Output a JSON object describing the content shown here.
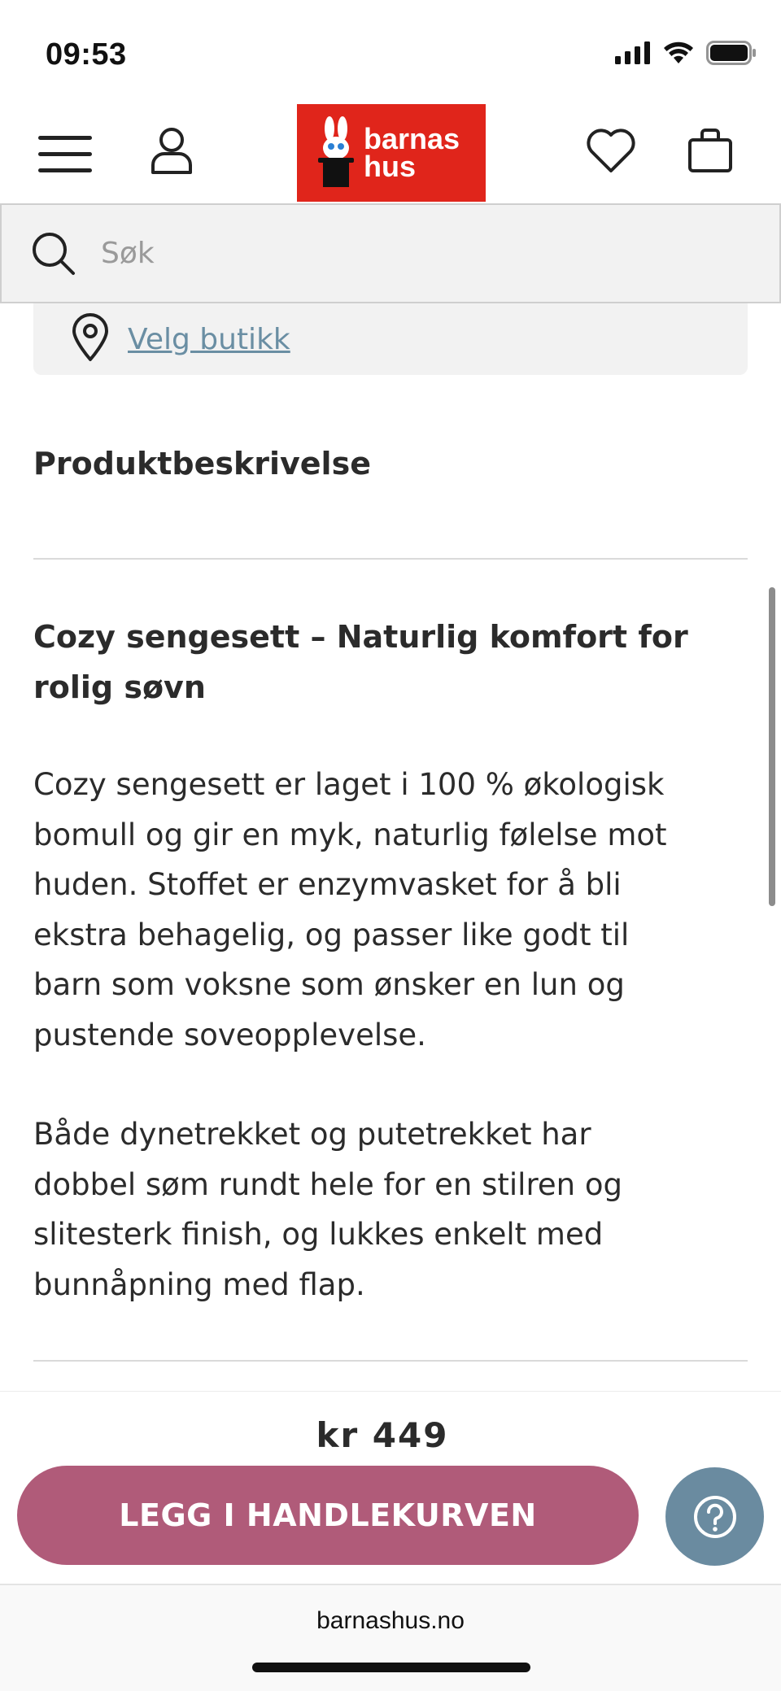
{
  "status_bar": {
    "time": "09:53"
  },
  "header": {
    "logo_line1": "barnas",
    "logo_line2": "hus"
  },
  "search": {
    "placeholder": "Søk"
  },
  "store": {
    "link_label": "Velg butikk"
  },
  "description": {
    "section_title": "Produktbeskrivelse",
    "heading_line1": "Cozy sengesett – Naturlig komfort for",
    "heading_line2": "rolig søvn",
    "paragraph1": [
      "Cozy sengesett er laget i 100 % økologisk",
      "bomull og gir en myk, naturlig følelse mot",
      "huden. Stoffet er enzymvasket for å bli",
      "ekstra behagelig, og passer like godt til",
      "barn som voksne som ønsker en lun og",
      "pustende soveopplevelse."
    ],
    "paragraph2": [
      "Både dynetrekket og putetrekket har",
      "dobbel søm rundt hele for en stilren og",
      "slitesterk finish, og lukkes enkelt med",
      "bunnåpning med flap."
    ]
  },
  "buy": {
    "price": "kr 449",
    "cart_button_label": "LEGG I HANDLEKURVEN"
  },
  "browser": {
    "url": "barnashus.no"
  },
  "colors": {
    "brand_red": "#e0251b",
    "cart_button": "#b05b79",
    "help_button": "#6a8ba0",
    "link": "#6a8ea3"
  }
}
